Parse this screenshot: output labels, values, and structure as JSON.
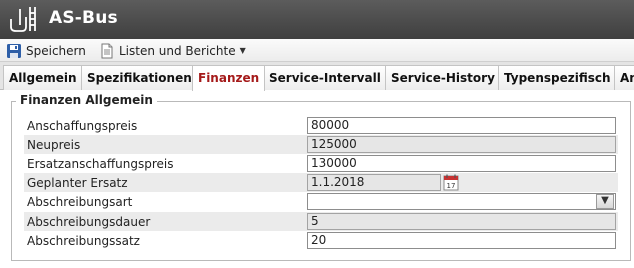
{
  "app": {
    "title": "AS-Bus"
  },
  "toolbar": {
    "save_label": "Speichern",
    "lists_label": "Listen und Berichte"
  },
  "tabs": [
    {
      "label": "Allgemein"
    },
    {
      "label": "Spezifikationen"
    },
    {
      "label": "Finanzen"
    },
    {
      "label": "Service-Intervall"
    },
    {
      "label": "Service-History"
    },
    {
      "label": "Typenspezifisch"
    },
    {
      "label": "An"
    }
  ],
  "active_tab": "Finanzen",
  "section": {
    "title": "Finanzen Allgemein"
  },
  "fields": [
    {
      "label": "Anschaffungspreis",
      "value": "80000"
    },
    {
      "label": "Neupreis",
      "value": "125000"
    },
    {
      "label": "Ersatzanschaffungspreis",
      "value": "130000"
    },
    {
      "label": "Geplanter Ersatz",
      "value": "1.1.2018"
    },
    {
      "label": "Abschreibungsart",
      "value": ""
    },
    {
      "label": "Abschreibungsdauer",
      "value": "5"
    },
    {
      "label": "Abschreibungssatz",
      "value": "20"
    }
  ],
  "colors": {
    "active_tab": "#a51a1a",
    "titlebar": "#4a4a4a",
    "calendar_accent": "#c83232"
  },
  "icons": [
    "bus-stop-icon",
    "save-icon",
    "document-icon",
    "calendar-icon",
    "chevron-down-icon"
  ]
}
